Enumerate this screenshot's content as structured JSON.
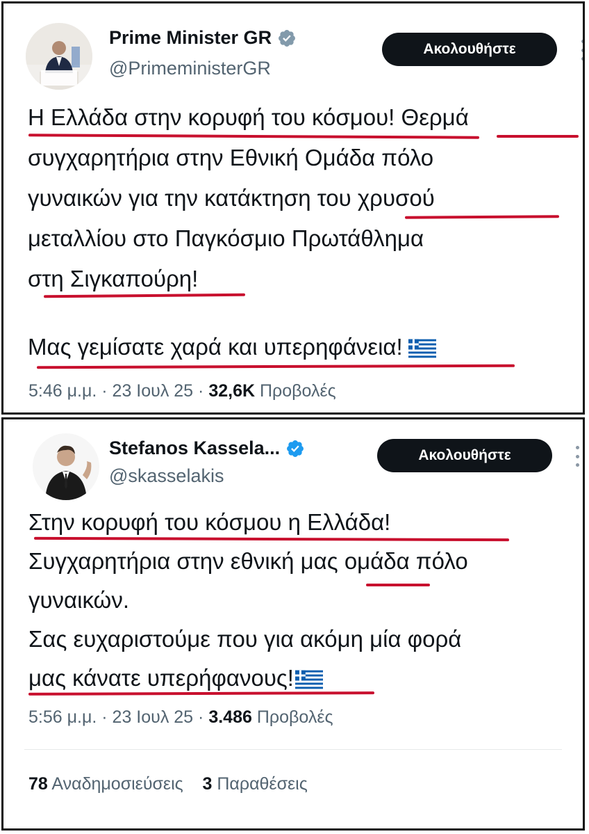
{
  "tweet1": {
    "display_name": "Prime Minister GR",
    "handle": "@PrimeministerGR",
    "follow_label": "Ακολουθήστε",
    "lines": [
      "Η Ελλάδα στην κορυφή του κόσμου! Θερμά",
      "συγχαρητήρια στην Εθνική Ομάδα πόλο",
      "γυναικών για την κατάκτηση του χρυσού",
      "μεταλλίου στο Παγκόσμιο Πρωτάθλημα",
      "στη Σιγκαπούρη!",
      "Μας γεμίσατε χαρά και υπερηφάνεια!"
    ],
    "time": "5:46 μ.μ.",
    "date": "23 Ιουλ 25",
    "views_count": "32,6K",
    "views_label": "Προβολές"
  },
  "tweet2": {
    "display_name": "Stefanos Kassela...",
    "handle": "@skasselakis",
    "follow_label": "Ακολουθήστε",
    "lines": [
      "Στην κορυφή του κόσμου η Ελλάδα!",
      "Συγχαρητήρια στην εθνική μας ομάδα πόλο",
      "γυναικών.",
      "Σας ευχαριστούμε που για ακόμη μία φορά",
      "μας κάνατε υπερήφανους!"
    ],
    "time": "5:56 μ.μ.",
    "date": "23 Ιουλ 25",
    "views_count": "3.486",
    "views_label": "Προβολές",
    "reposts_count": "78",
    "reposts_label": "Αναδημοσιεύσεις",
    "quotes_count": "3",
    "quotes_label": "Παραθέσεις"
  },
  "separator": "·",
  "colors": {
    "underline": "#c8102e",
    "verified": "#1d9bf0",
    "verified_gov": "#829aab",
    "button": "#0f1419",
    "secondary_text": "#536471"
  },
  "icons": [
    "verified-badge-icon",
    "more-options-icon",
    "greek-flag-icon"
  ]
}
